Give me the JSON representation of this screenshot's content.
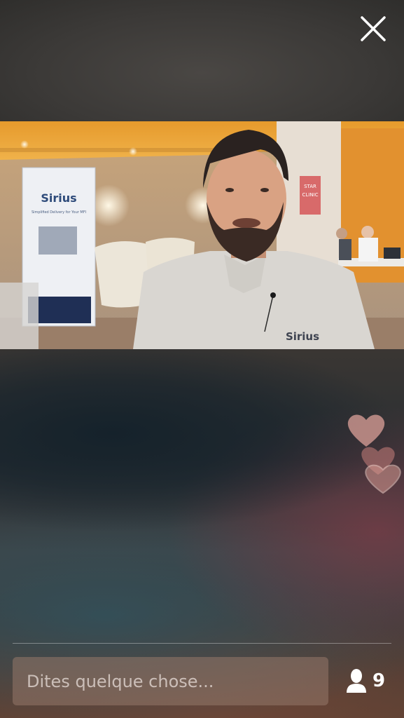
{
  "comment": {
    "placeholder": "Dites quelque chose..."
  },
  "viewers": {
    "count": "9",
    "icon": "person-icon"
  },
  "close": {
    "icon": "close-icon"
  },
  "video": {
    "banner_brand": "Sirius",
    "banner_tagline": "Simplified Delivery for Your MFI",
    "shirt_brand": "Sirius",
    "sign_top": "STAR",
    "sign_bottom": "CLINIC"
  },
  "colors": {
    "heart": "#e8a8a0",
    "accent": "#ffffff"
  }
}
